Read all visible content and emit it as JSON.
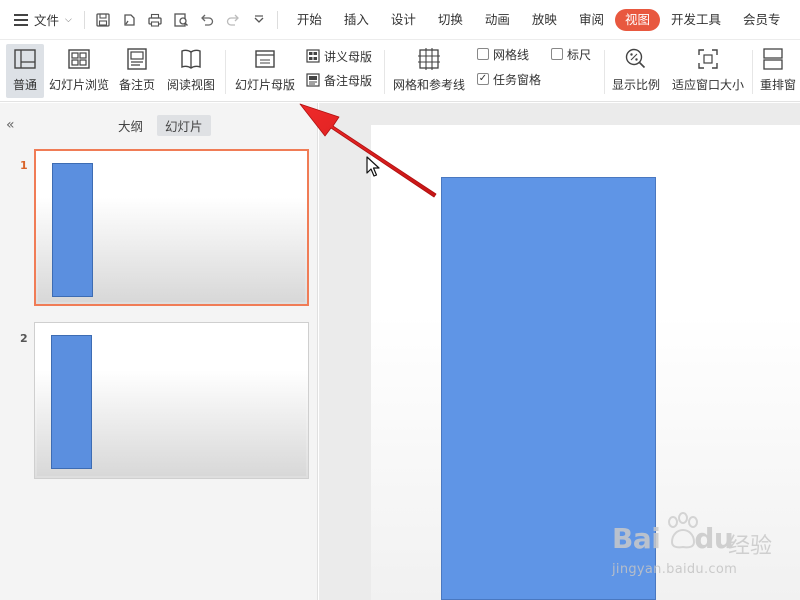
{
  "menubar": {
    "file_label": "文件",
    "tabs": [
      "开始",
      "插入",
      "设计",
      "切换",
      "动画",
      "放映",
      "审阅",
      "视图",
      "开发工具",
      "会员专"
    ],
    "active_tab": "视图"
  },
  "ribbon": {
    "normal": "普通",
    "slide_sorter": "幻灯片浏览",
    "notes_page": "备注页",
    "reading_view": "阅读视图",
    "slide_master": "幻灯片母版",
    "handout_master": "讲义母版",
    "notes_master": "备注母版",
    "grid_guides": "网格和参考线",
    "gridlines": "网格线",
    "ruler": "标尺",
    "task_pane": "任务窗格",
    "zoom": "显示比例",
    "fit_window": "适应窗口大小",
    "arrange": "重排窗"
  },
  "left_panel": {
    "tab_outline": "大纲",
    "tab_slides": "幻灯片",
    "slides": [
      {
        "number": "1",
        "selected": true
      },
      {
        "number": "2",
        "selected": false
      }
    ]
  },
  "watermark": {
    "brand": "Bai",
    "brand2": "du",
    "cn": "经验",
    "url": "jingyan.baidu.com"
  },
  "colors": {
    "accent": "#e8583f",
    "shape_fill": "#5b8fdf",
    "arrow": "#e02020"
  }
}
